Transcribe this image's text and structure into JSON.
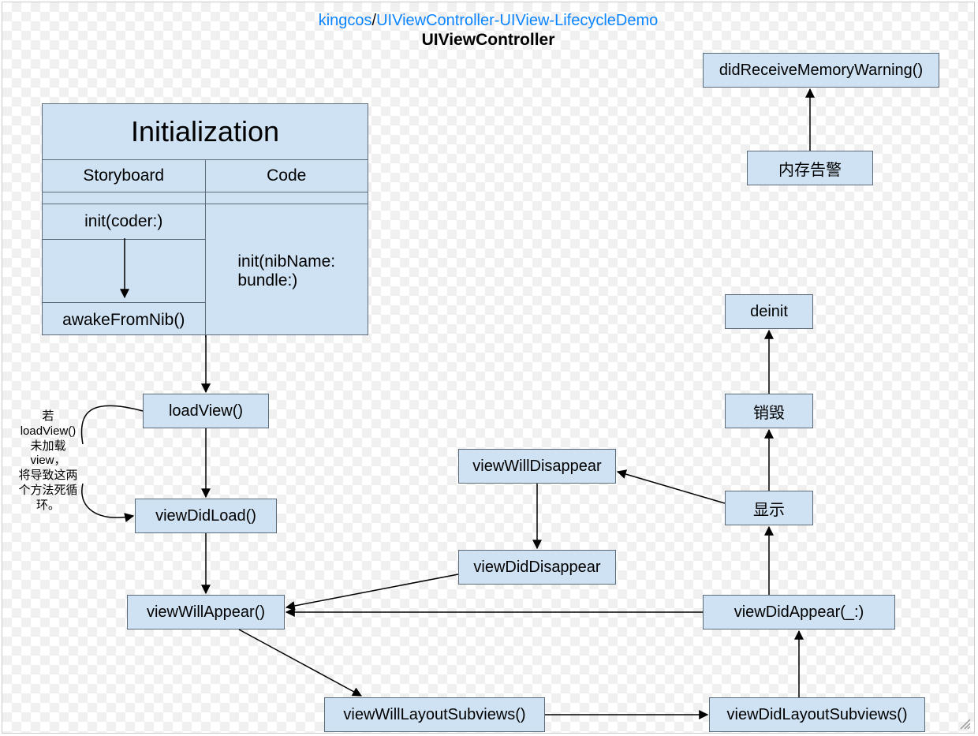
{
  "header": {
    "author": "kingcos",
    "sep": "/",
    "repo": "UIViewController-UIView-LifecycleDemo",
    "subtitle": "UIViewController"
  },
  "init": {
    "title": "Initialization",
    "left_header": "Storyboard",
    "right_header": "Code",
    "left_top": "init(coder:)",
    "left_bottom": "awakeFromNib()",
    "right": "init(nibName:\nbundle:)"
  },
  "nodes": {
    "loadView": "loadView()",
    "viewDidLoad": "viewDidLoad()",
    "viewWillAppear": "viewWillAppear()",
    "viewWillLayoutSubviews": "viewWillLayoutSubviews()",
    "viewDidLayoutSubviews": "viewDidLayoutSubviews()",
    "viewDidAppear": "viewDidAppear(_:)",
    "display": "显示",
    "viewWillDisappear": "viewWillDisappear",
    "viewDidDisappear": "viewDidDisappear",
    "destroy": "销毁",
    "deinit": "deinit",
    "memoryWarning": "内存告警",
    "didReceiveMemoryWarning": "didReceiveMemoryWarning()"
  },
  "note": {
    "loop": "若\nloadView()\n未加载\nview，\n将导致这两\n个方法死循\n环。"
  }
}
